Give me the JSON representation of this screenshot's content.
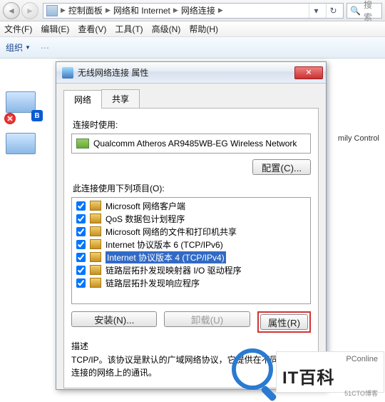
{
  "breadcrumbs": {
    "items": [
      "控制面板",
      "网络和 Internet",
      "网络连接"
    ]
  },
  "search": {
    "placeholder": "搜索"
  },
  "menubar": {
    "items": [
      "文件(F)",
      "编辑(E)",
      "查看(V)",
      "工具(T)",
      "高级(N)",
      "帮助(H)"
    ]
  },
  "toolbar": {
    "org": "组织"
  },
  "rightlabel": "mily Control",
  "dialog": {
    "title": "无线网络连接 属性",
    "tabs": [
      "网络",
      "共享"
    ],
    "connect_using": "连接时使用:",
    "adapter": "Qualcomm Atheros AR9485WB-EG Wireless Network",
    "configure": "配置(C)...",
    "items_label": "此连接使用下列项目(O):",
    "items": [
      {
        "checked": true,
        "label": "Microsoft 网络客户端"
      },
      {
        "checked": true,
        "label": "QoS 数据包计划程序"
      },
      {
        "checked": true,
        "label": "Microsoft 网络的文件和打印机共享"
      },
      {
        "checked": true,
        "label": "Internet 协议版本 6 (TCP/IPv6)"
      },
      {
        "checked": true,
        "label": "Internet 协议版本 4 (TCP/IPv4)",
        "selected": true
      },
      {
        "checked": true,
        "label": "链路层拓扑发现映射器 I/O 驱动程序"
      },
      {
        "checked": true,
        "label": "链路层拓扑发现响应程序"
      }
    ],
    "install": "安装(N)...",
    "uninstall": "卸载(U)",
    "properties": "属性(R)",
    "desc_head": "描述",
    "desc_text": "TCP/IP。该协议是默认的广域网络协议，它提供在不同的相互连接的网络上的通讯。"
  },
  "watermark": {
    "small": "PConline",
    "big": "IT百科",
    "sub": "51CTO博客"
  }
}
